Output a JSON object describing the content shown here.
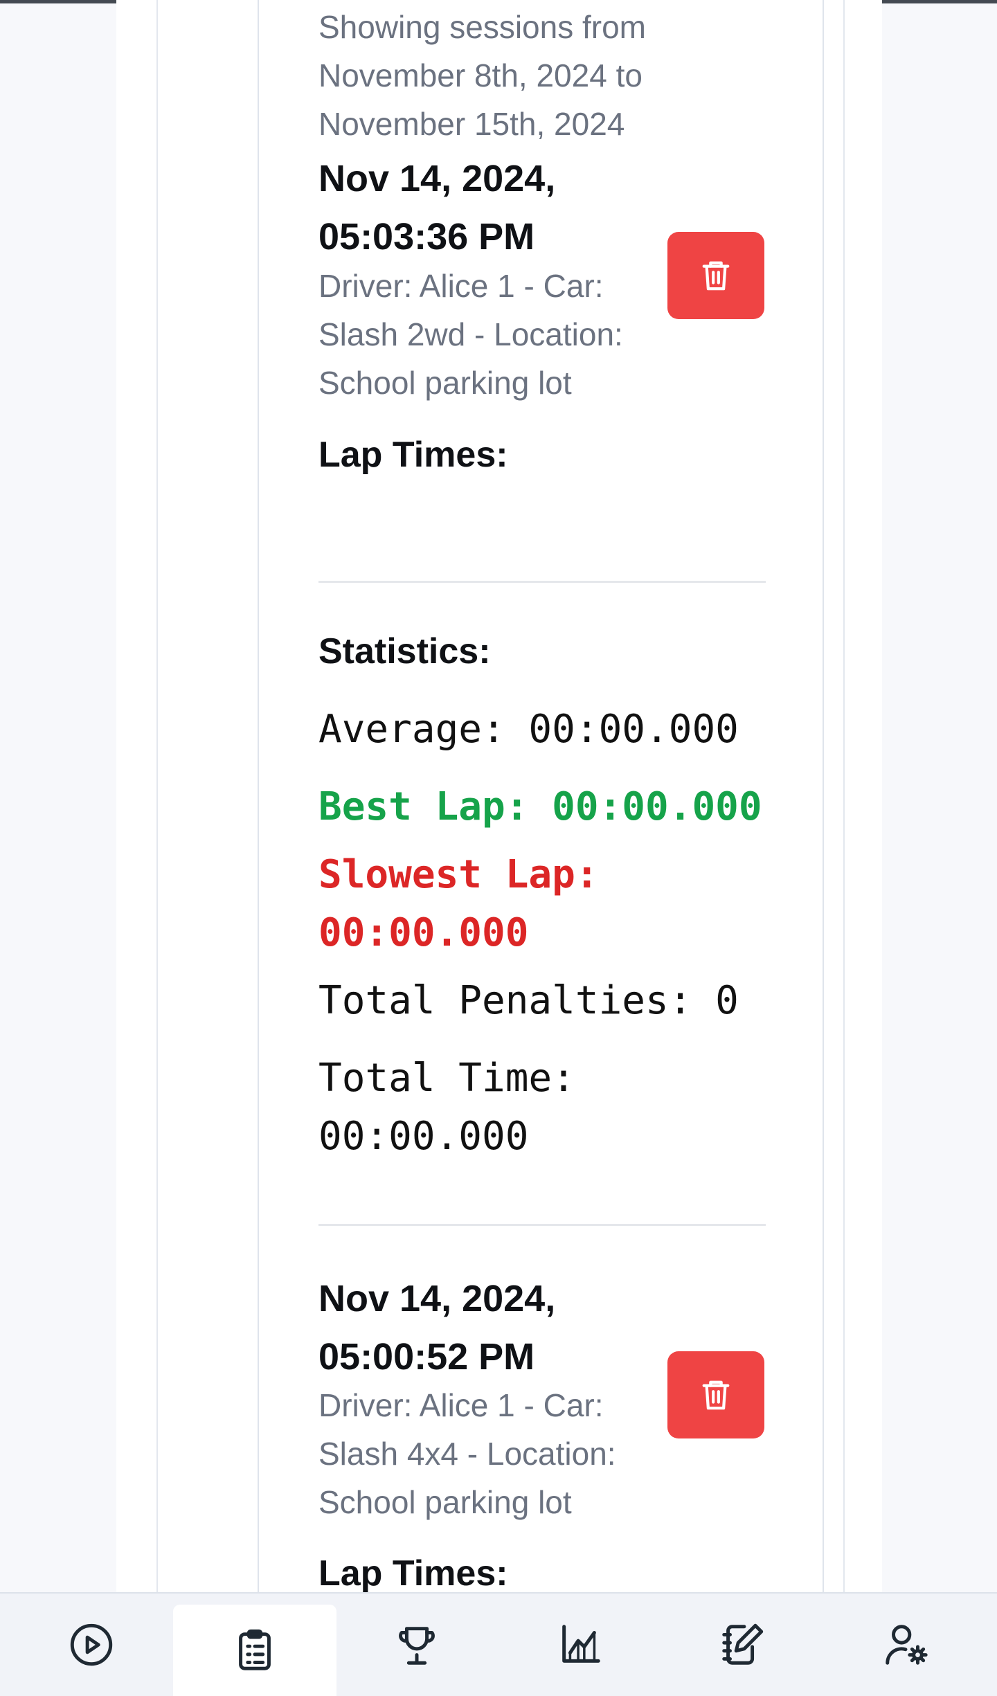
{
  "filter": {
    "range_text": "Showing sessions from November 8th, 2024 to November 15th, 2024"
  },
  "sessions": [
    {
      "date": "Nov 14, 2024, 05:03:36 PM",
      "meta": "Driver: Alice 1 - Car: Slash 2wd - Location: School parking lot",
      "lap_times_label": "Lap Times:",
      "statistics_label": "Statistics:",
      "average": "Average: 00:00.000",
      "best_lap": "Best Lap: 00:00.000",
      "slowest_lap": "Slowest Lap: 00:00.000",
      "total_penalties": "Total Penalties: 0",
      "total_time": "Total Time: 00:00.000",
      "delete_icon": "trash-icon"
    },
    {
      "date": "Nov 14, 2024, 05:00:52 PM",
      "meta": "Driver: Alice 1 - Car: Slash 4x4 - Location: School parking lot",
      "lap_times_label": "Lap Times:",
      "delete_icon": "trash-icon"
    }
  ],
  "bottom_nav": {
    "items": [
      {
        "icon": "play-circle-icon",
        "active": false
      },
      {
        "icon": "clipboard-list-icon",
        "active": true
      },
      {
        "icon": "trophy-icon",
        "active": false
      },
      {
        "icon": "chart-icon",
        "active": false
      },
      {
        "icon": "notebook-edit-icon",
        "active": false
      },
      {
        "icon": "user-settings-icon",
        "active": false
      }
    ]
  },
  "colors": {
    "delete": "#ef4444",
    "best": "#16a34a",
    "slowest": "#dc2626",
    "muted_text": "#6b7280"
  }
}
